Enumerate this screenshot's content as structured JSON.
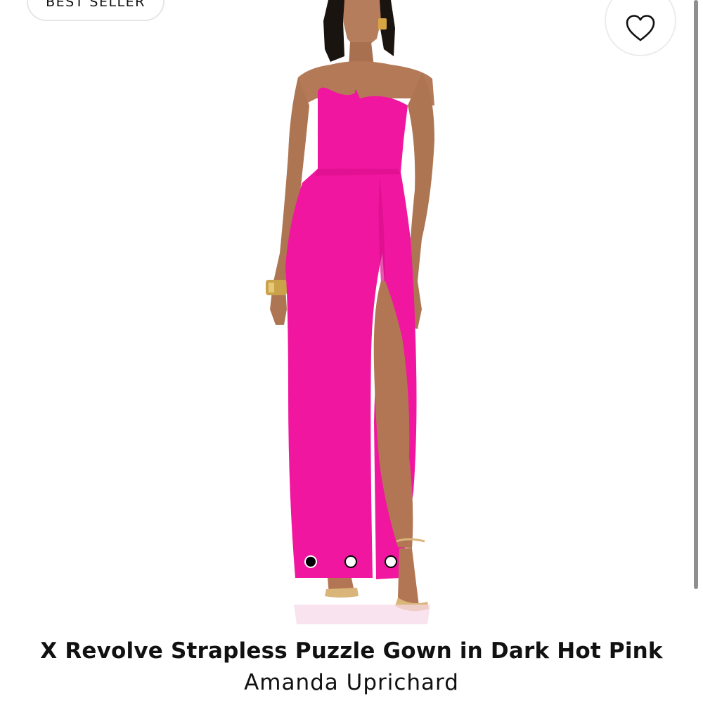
{
  "badge": {
    "label": "BEST SELLER"
  },
  "wishlist": {
    "icon": "heart-icon"
  },
  "product": {
    "title": "X Revolve Strapless Puzzle Gown in Dark Hot Pink",
    "brand": "Amanda Uprichard",
    "dress_color": "#f1169f"
  },
  "carousel": {
    "total_images": 3,
    "active_index": 0
  },
  "colors": {
    "text": "#111111",
    "background": "#ffffff",
    "badge_border": "#e6e6e6"
  }
}
